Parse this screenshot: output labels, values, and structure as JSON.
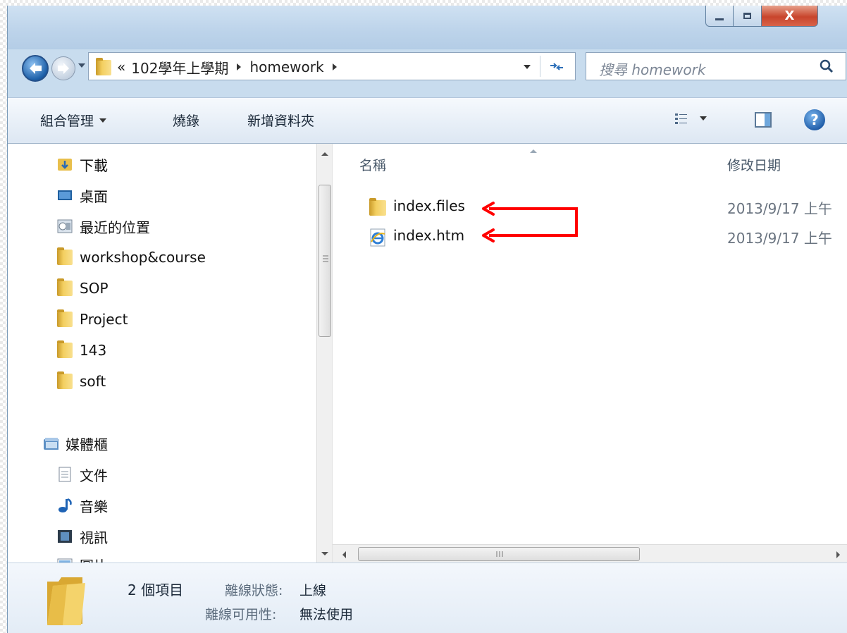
{
  "window": {
    "controls": {
      "minimize": "minimize",
      "maximize": "maximize",
      "close": "X"
    }
  },
  "address": {
    "overflow": "«",
    "breadcrumb": [
      "102學年上學期",
      "homework"
    ]
  },
  "search": {
    "placeholder": "搜尋 homework"
  },
  "toolbar": {
    "organize_label": "組合管理",
    "burn_label": "燒錄",
    "new_folder_label": "新增資料夾"
  },
  "nav": {
    "favorites": [
      {
        "label": "下載",
        "icon": "downloads-folder-icon"
      },
      {
        "label": "桌面",
        "icon": "desktop-icon"
      },
      {
        "label": "最近的位置",
        "icon": "recent-places-icon"
      },
      {
        "label": "workshop&course",
        "icon": "folder-icon"
      },
      {
        "label": "SOP",
        "icon": "folder-icon"
      },
      {
        "label": "Project",
        "icon": "folder-icon"
      },
      {
        "label": "143",
        "icon": "folder-icon"
      },
      {
        "label": "soft",
        "icon": "folder-icon"
      }
    ],
    "library": {
      "label": "媒體櫃",
      "icon": "library-icon"
    },
    "libraries": [
      {
        "label": "文件",
        "icon": "documents-icon"
      },
      {
        "label": "音樂",
        "icon": "music-icon"
      },
      {
        "label": "視訊",
        "icon": "video-icon"
      },
      {
        "label": "圖片",
        "icon": "pictures-icon"
      }
    ]
  },
  "columns": {
    "name": "名稱",
    "modified": "修改日期"
  },
  "files": [
    {
      "name": "index.files",
      "date": "2013/9/17 上午",
      "icon": "folder-icon"
    },
    {
      "name": "index.htm",
      "date": "2013/9/17 上午",
      "icon": "ie-html-icon"
    }
  ],
  "annotation": {
    "color": "#ff0000"
  },
  "details": {
    "count": "2 個項目",
    "offline_status_label": "離線狀態:",
    "offline_status_value": "上線",
    "offline_avail_label": "離線可用性:",
    "offline_avail_value": "無法使用"
  }
}
